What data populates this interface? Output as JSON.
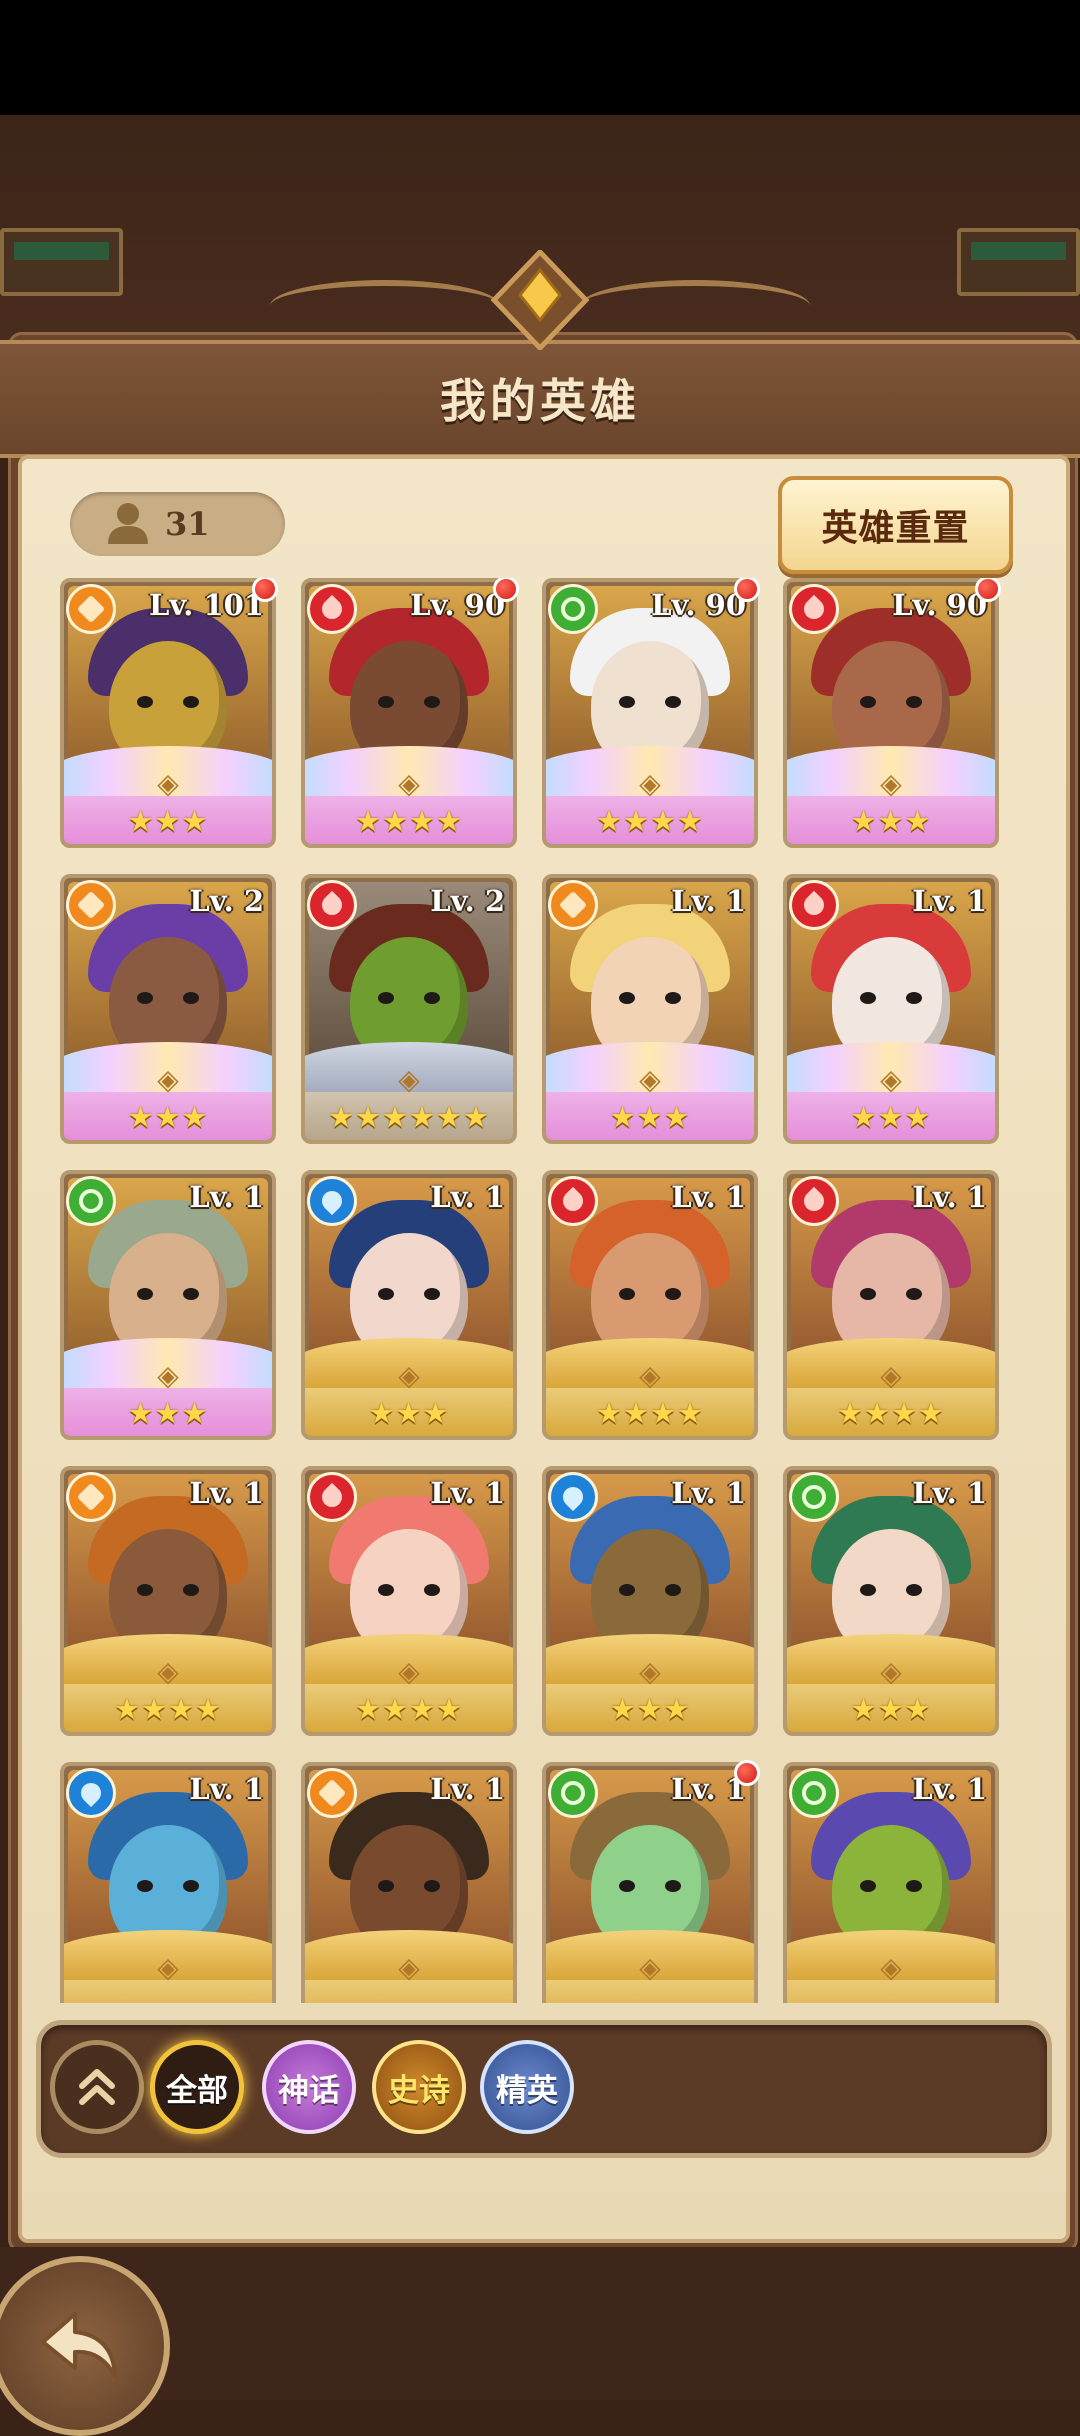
{
  "page": {
    "title": "我的英雄",
    "hero_count": "31",
    "reset_button": "英雄重置"
  },
  "colors": {
    "mythic": "#e58fd9",
    "epic": "#d8a93c",
    "earth": "#f08a1e",
    "fire": "#d9252b",
    "nature": "#3fae34",
    "water": "#1e82d9"
  },
  "heroes": [
    {
      "level": "Lv. 101",
      "element": "earth",
      "rarity": "mythic",
      "stars": "★★★",
      "red_dot": true,
      "skin": "#c9a13a",
      "hair": "#4a2f6a"
    },
    {
      "level": "Lv. 90",
      "element": "fire",
      "rarity": "mythic",
      "stars": "★★★★",
      "red_dot": true,
      "skin": "#7b4a33",
      "hair": "#b2262c"
    },
    {
      "level": "Lv. 90",
      "element": "nature",
      "rarity": "mythic",
      "stars": "★★★★",
      "red_dot": true,
      "skin": "#f0e0d0",
      "hair": "#f2f2f2"
    },
    {
      "level": "Lv. 90",
      "element": "fire",
      "rarity": "mythic",
      "stars": "★★★",
      "red_dot": true,
      "skin": "#a9684a",
      "hair": "#9e2e2a"
    },
    {
      "level": "Lv. 2",
      "element": "earth",
      "rarity": "mythic",
      "stars": "★★★",
      "red_dot": false,
      "skin": "#8a5a42",
      "hair": "#6a3ea6"
    },
    {
      "level": "Lv. 2",
      "element": "fire",
      "rarity": "plain",
      "stars": "★★★★★★",
      "red_dot": false,
      "skin": "#6f9d2f",
      "hair": "#6a2a1e"
    },
    {
      "level": "Lv. 1",
      "element": "earth",
      "rarity": "mythic",
      "stars": "★★★",
      "red_dot": false,
      "skin": "#f3d3b6",
      "hair": "#f2d37a"
    },
    {
      "level": "Lv. 1",
      "element": "fire",
      "rarity": "mythic",
      "stars": "★★★",
      "red_dot": false,
      "skin": "#f2e6e0",
      "hair": "#d93a3a"
    },
    {
      "level": "Lv. 1",
      "element": "nature",
      "rarity": "mythic",
      "stars": "★★★",
      "red_dot": false,
      "skin": "#d8b08c",
      "hair": "#9aa88e"
    },
    {
      "level": "Lv. 1",
      "element": "water",
      "rarity": "epic",
      "stars": "★★★",
      "red_dot": false,
      "skin": "#f1d7cc",
      "hair": "#253f7a"
    },
    {
      "level": "Lv. 1",
      "element": "fire",
      "rarity": "epic",
      "stars": "★★★★",
      "red_dot": false,
      "skin": "#d99a72",
      "hair": "#d4622a"
    },
    {
      "level": "Lv. 1",
      "element": "fire",
      "rarity": "epic",
      "stars": "★★★★",
      "red_dot": false,
      "skin": "#e6b7a6",
      "hair": "#b23a6a"
    },
    {
      "level": "Lv. 1",
      "element": "earth",
      "rarity": "epic",
      "stars": "★★★★",
      "red_dot": false,
      "skin": "#8a5a3a",
      "hair": "#c46a22"
    },
    {
      "level": "Lv. 1",
      "element": "fire",
      "rarity": "epic",
      "stars": "★★★★",
      "red_dot": false,
      "skin": "#f6d2c2",
      "hair": "#f07a70"
    },
    {
      "level": "Lv. 1",
      "element": "water",
      "rarity": "epic",
      "stars": "★★★",
      "red_dot": false,
      "skin": "#8a6a3a",
      "hair": "#3a6ab2"
    },
    {
      "level": "Lv. 1",
      "element": "nature",
      "rarity": "epic",
      "stars": "★★★",
      "red_dot": false,
      "skin": "#f2d8c6",
      "hair": "#2f7a52"
    },
    {
      "level": "Lv. 1",
      "element": "water",
      "rarity": "epic",
      "stars": "",
      "red_dot": false,
      "skin": "#5ab0d8",
      "hair": "#2b6aa8"
    },
    {
      "level": "Lv. 1",
      "element": "earth",
      "rarity": "epic",
      "stars": "",
      "red_dot": false,
      "skin": "#7a4a2e",
      "hair": "#3a2a1e"
    },
    {
      "level": "Lv. 1",
      "element": "nature",
      "rarity": "epic",
      "stars": "",
      "red_dot": true,
      "skin": "#8fd08a",
      "hair": "#8a6a3a"
    },
    {
      "level": "Lv. 1",
      "element": "nature",
      "rarity": "epic",
      "stars": "",
      "red_dot": false,
      "skin": "#8cb33a",
      "hair": "#5a4ab0"
    }
  ],
  "filters": {
    "all": "全部",
    "mythic": "神话",
    "epic": "史诗",
    "elite": "精英"
  },
  "icons": {
    "collapse": "double-chevron-up-icon",
    "back": "back-arrow-icon",
    "count": "person-icon"
  }
}
